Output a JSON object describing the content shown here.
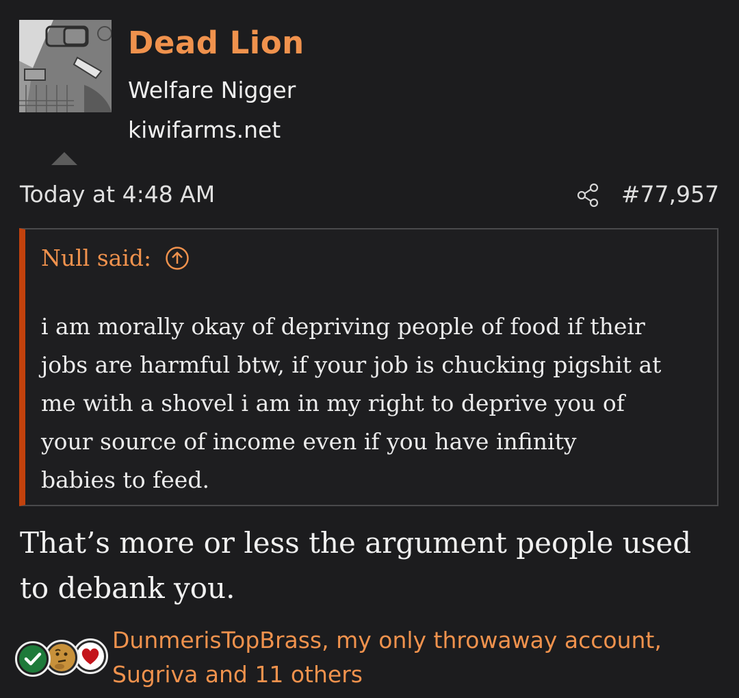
{
  "user": {
    "name": "Dead Lion",
    "title": "Welfare Nigger",
    "site": "kiwifarms.net"
  },
  "post": {
    "date": "Today at 4:48 AM",
    "number": "#77,957",
    "body_line_1": "That’s more or less the argument people used",
    "body_line_2": "to debank you."
  },
  "quote": {
    "author_label": "Null said:",
    "lines": [
      "i am morally okay of depriving people of food if their",
      "jobs are harmful btw, if your job is chucking pigshit at",
      "me with a shovel i am in my right to deprive you of",
      "your source of income even if you have infinity",
      "babies to feed."
    ]
  },
  "reactions": {
    "icons": [
      "checkmark-reaction-icon",
      "thinking-face-reaction-icon",
      "heart-reaction-icon"
    ],
    "reactors_line_1": "DunmerisTopBrass, my only throwaway account,",
    "reactors_line_2": "Sugriva and 11 others"
  },
  "colors": {
    "accent": "#f0924d",
    "quote_bar": "#c2420d",
    "background": "#1c1c1e"
  }
}
